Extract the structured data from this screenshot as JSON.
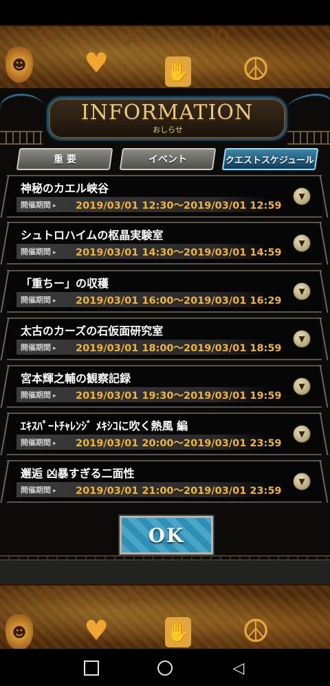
{
  "header": {
    "title": "INFORMATION",
    "subtitle": "おしらせ"
  },
  "banner": {
    "tiles": [
      "JO",
      "JO",
      "JO",
      "JO",
      "JO"
    ],
    "emblems": [
      "mask-icon",
      "heart-icon",
      "hand-icon",
      "peace-icon"
    ]
  },
  "tabs": [
    {
      "label": "重 要",
      "active": false
    },
    {
      "label": "イベント",
      "active": false
    },
    {
      "label": "クエストスケジュール",
      "active": true
    }
  ],
  "period_label": "開催期間",
  "items": [
    {
      "title": "神秘のカエル峡谷",
      "period": "2019/03/01 12:30〜2019/03/01 12:59"
    },
    {
      "title": "シュトロハイムの枢晶実験室",
      "period": "2019/03/01 14:30〜2019/03/01 14:59"
    },
    {
      "title": "「重ちー」の収穫",
      "period": "2019/03/01 16:00〜2019/03/01 16:29"
    },
    {
      "title": "太古のカーズの石仮面研究室",
      "period": "2019/03/01 18:00〜2019/03/01 18:59"
    },
    {
      "title": "宮本輝之輔の観察記録",
      "period": "2019/03/01 19:30〜2019/03/01 19:59"
    },
    {
      "title": "ｴｷｽﾊﾟｰﾄﾁｬﾚﾝｼﾞ ﾒｷｼｺに吹く熱風 編",
      "period": "2019/03/01 20:00〜2019/03/01 23:59"
    },
    {
      "title": "邂逅 凶暴すぎる二面性",
      "period": "2019/03/01 21:00〜2019/03/01 23:59"
    }
  ],
  "ok_button": {
    "label": "OK"
  },
  "colors": {
    "accent": "#f0b33a",
    "tab_active": "#2f6f92",
    "ok": "#3a9dc2"
  },
  "navbar": {
    "icons": [
      "square-icon",
      "circle-icon",
      "back-triangle-icon"
    ]
  }
}
